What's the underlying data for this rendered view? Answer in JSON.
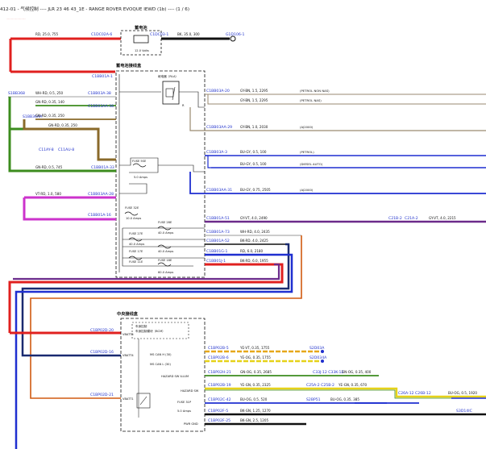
{
  "header": {
    "title": "412-01 - 气候控制 ---- JLR 23 46 43_1E - RANGE ROVER EVOQUE IEWD (1b) ---- (1 / 6)",
    "subtitle": "·····························"
  },
  "colors": {
    "red": "#e0201f",
    "green": "#3c8c1e",
    "brown": "#8a6a2a",
    "blue": "#1f2fd0",
    "purple": "#6b2a8a",
    "magenta": "#cc33cc",
    "orange": "#d05a10",
    "yellow": "#e6d21a",
    "navy": "#1a2a70",
    "dark": "#222222",
    "conn": "#2233cc"
  },
  "battery": {
    "title": "蓄电池",
    "volts": "12.0 Volts",
    "left_conn": "C1DC02A-6",
    "right_conn": "C1DC03-1",
    "wire_left": "RD, 25.0, 755",
    "wire_right": "BK, 35.0, 300",
    "ground": "G1D106-1"
  },
  "bjb": {
    "title": "蓄电池接线盒",
    "relay_title": "继电器（RLA）",
    "relay_note": "R",
    "fuses": [
      {
        "name": "FUSE 5SE",
        "rating": "5.0 Amps"
      },
      {
        "name": "FUSE 32E",
        "rating": "10.0 Amps"
      },
      {
        "name": "FUSE 28E",
        "rating": "40.0 Amps"
      },
      {
        "name": "FUSE 27E",
        "rating": "40.0 Amps"
      },
      {
        "name": "FUSE 17E",
        "rating": "40.0 Amps"
      },
      {
        "name": "FUSE 11E",
        "rating": "60.0 Amps"
      },
      {
        "name": "FUSE 18E",
        "rating": "60.0 Amps"
      }
    ]
  },
  "left_conns": [
    "C1BB01A-1",
    "C1BB03A-38",
    "C1BB03AA-38",
    "C1BB01A-33",
    "C1BB03AA-28",
    "C1BB01A-16",
    "S1BB368",
    "S1BB36AA",
    "C11AY-8",
    "C11AU-8"
  ],
  "left_wires": [
    "WH-RD, 0.5, 250",
    "GN-RD, 0.35, 140",
    "GN-RD, 0.35, 250",
    "GN-RD, 0.35, 250",
    "GN-RD, 0.5, 745",
    "VT-RD, 1.0, 580"
  ],
  "right_rows": [
    {
      "conn": "C1BB03A-20",
      "wire": "GY-BN, 1.5, 2295",
      "desc": "(PETROL NON NAS)"
    },
    {
      "conn": "",
      "wire": "GY-BN, 1.5, 2295",
      "desc": "(PETROL NAS)"
    },
    {
      "conn": "C1BB03AA-29",
      "wire": "GY-BN, 1.0, 2030",
      "desc": "(AJ2000)"
    },
    {
      "conn": "C1BB03A-3",
      "wire": "BU-GY, 0.5, 100",
      "desc": "(PETROL)"
    },
    {
      "conn": "",
      "wire": "BU-GY, 0.5, 100",
      "desc": "(DIESEL AUTO)"
    },
    {
      "conn": "C1BB03AA-31",
      "wire": "BU-GY, 0.75, 2505",
      "desc": "(AJ2000)"
    },
    {
      "conn": "C1BB01A-51",
      "wire": "GY-VT, 4.0, 2490",
      "desc": ""
    },
    {
      "conn": "C1BB01A-73",
      "wire": "WH-RD, 4.0, 2435",
      "desc": ""
    },
    {
      "conn": "C1BB01A-52",
      "wire": "BK-RD, 4.0, 2425",
      "desc": ""
    },
    {
      "conn": "C1BB01G-1",
      "wire": "RD, 6.0, 2180",
      "desc": ""
    },
    {
      "conn": "C1BB01J-1",
      "wire": "BK-RD, 6.0, 1955",
      "desc": ""
    }
  ],
  "far_right": {
    "conn1": "C21B-2",
    "conn2": "C21A-2",
    "wire": "GY-VT, 4.0, 2215"
  },
  "cjb": {
    "title": "中央接线盒",
    "module_title": "车身控制模块（BCM）",
    "module_title2": "车身控制",
    "left_conns": [
      "C1BP02D-20",
      "C1BP02D-16",
      "C1BP02D-21"
    ],
    "pins": [
      "VBATT5",
      "VBATT4",
      "VBATT1",
      "MS CAN H (30)",
      "MS CAN L (30)",
      "HAZARD SW ILLUM",
      "HAZARD SW",
      "FUSE 31P",
      "5.0 Amps",
      "PWR GND"
    ],
    "right_rows": [
      {
        "conn": "C1BP02B-5",
        "wire": "YE-VT, 0.35, 1755",
        "end": "S2D03A"
      },
      {
        "conn": "C1BP02B-6",
        "wire": "YE-OG, 0.35, 1755",
        "end": "S2D034A"
      },
      {
        "conn": "C1BP02H-21",
        "wire": "GN-OG, 0.35, 2685",
        "mid": "C33J-12  C33K-12",
        "wire2": "GN-OG, 0.35, 400"
      },
      {
        "conn": "C1BP02B-19",
        "wire": "YE-GN, 0.35, 2325",
        "mid": "C25A-2  C25B-2",
        "wire2": "YE-GN, 0.35, 670"
      },
      {
        "conn": "C1BP02C-42",
        "wire": "BU-OG, 0.5, 520",
        "mid": "S2BP51",
        "wire2": "BU-OG, 0.35, 385"
      },
      {
        "conn": "C1BP02F-5",
        "wire": "BK-GN, 1.25, 1270",
        "end": ""
      },
      {
        "conn": "C1BP02F-25",
        "wire": "BK-GN, 2.5, 1205",
        "end": ""
      }
    ],
    "far": {
      "mid": "C26A-12 C26B-12",
      "wire": "BU-OG, 0.5, 1920",
      "end": "S3D14IC"
    }
  }
}
